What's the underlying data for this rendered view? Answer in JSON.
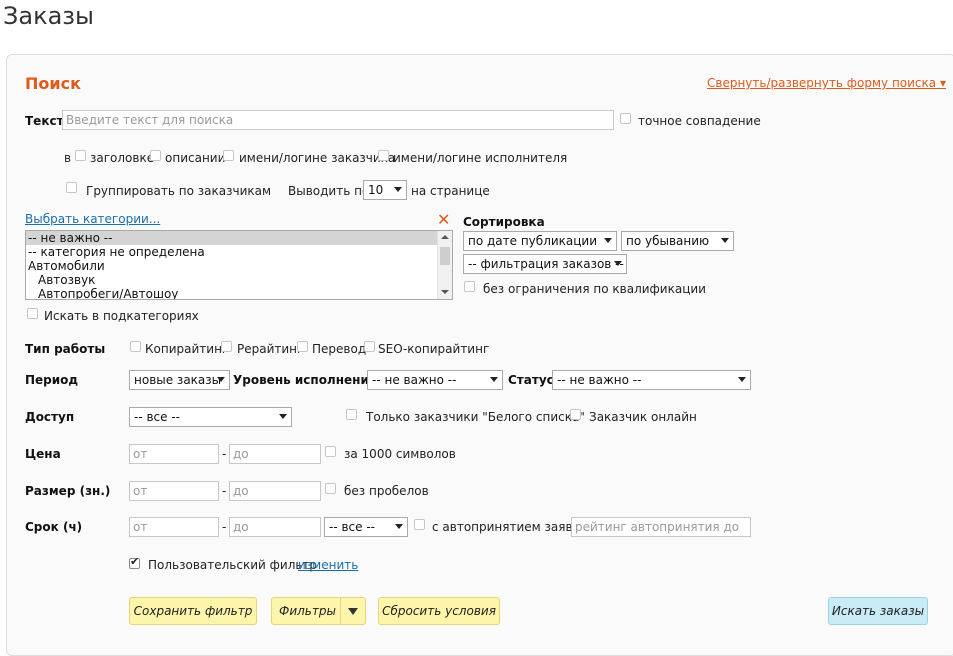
{
  "page_title": "Заказы",
  "search": {
    "title": "Поиск",
    "toggle_link": "Свернуть/развернуть форму поиска ▾",
    "text_label": "Текст",
    "text_placeholder": "Введите текст для поиска",
    "exact_match": "точное совпадение",
    "in_label": "в",
    "in_options": [
      "заголовке",
      "описании",
      "имени/логине заказчика",
      "имени/логине исполнителя"
    ],
    "group_by_customers": "Группировать по заказчикам",
    "per_page_label": "Выводить по",
    "per_page_value": "10",
    "per_page_suffix": "на странице"
  },
  "categories": {
    "link": "Выбрать категории...",
    "items": [
      "-- не важно --",
      "-- категория не определена",
      "Автомобили",
      "Автозвук",
      "Автопробеги/Автошоу"
    ],
    "search_subcategories": "Искать в подкатегориях"
  },
  "sorting": {
    "label": "Сортировка",
    "sort_by": "по дате публикации",
    "order": "по убыванию",
    "filter": "-- фильтрация заказов --",
    "no_qualification_limit": "без ограничения по квалификации"
  },
  "work_type": {
    "label": "Тип работы",
    "options": [
      "Копирайтинг",
      "Рерайтинг",
      "Перевод",
      "SEO-копирайтинг"
    ]
  },
  "period": {
    "label": "Период",
    "value": "новые заказы",
    "level_label": "Уровень исполнения",
    "level_value": "-- не важно --",
    "status_label": "Статус",
    "status_value": "-- не важно --"
  },
  "access": {
    "label": "Доступ",
    "value": "-- все --",
    "whitelist_only": "Только заказчики \"Белого списка\"",
    "customer_online": "Заказчик онлайн"
  },
  "price": {
    "label": "Цена",
    "from_placeholder": "от",
    "to_placeholder": "до",
    "dash": "-",
    "per_1000": "за 1000 символов"
  },
  "size": {
    "label": "Размер (зн.)",
    "from_placeholder": "от",
    "to_placeholder": "до",
    "dash": "-",
    "no_spaces": "без пробелов"
  },
  "term": {
    "label": "Срок (ч)",
    "from_placeholder": "от",
    "to_placeholder": "до",
    "dash": "-",
    "select_value": "-- все --",
    "auto_accept": "с автопринятием заявок",
    "rating_placeholder": "рейтинг автопринятия до"
  },
  "user_filter": {
    "label": "Пользовательский фильтр",
    "link": "изменить",
    "checked": true
  },
  "buttons": {
    "save_filter": "Сохранить фильтр",
    "filters": "Фильтры",
    "reset": "Сбросить условия",
    "search_orders": "Искать заказы"
  },
  "colors": {
    "accent": "#e05a1b",
    "link": "#1a6fa8",
    "button_yellow": "#fdf5a9",
    "button_blue": "#c9ecf7"
  }
}
